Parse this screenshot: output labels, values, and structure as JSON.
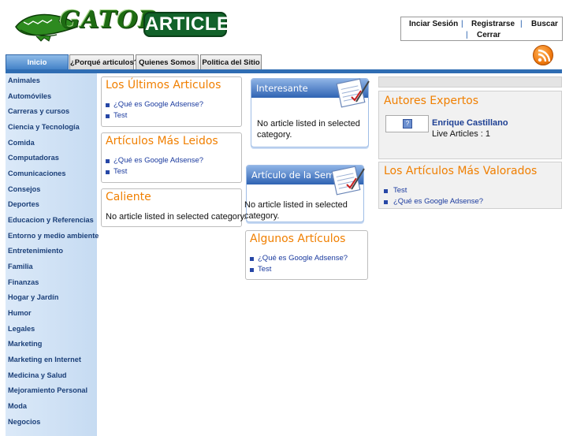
{
  "logo": {
    "gator_text": "GATOR",
    "articles_text": "ARTICLES"
  },
  "topbar": {
    "login": "Inciar Sesión",
    "register": "Registrarse",
    "search": "Buscar",
    "logout": "Cerrar",
    "separator": "|"
  },
  "tabs": [
    {
      "label": "Inicio"
    },
    {
      "label": "¿Porqué articulos?"
    },
    {
      "label": "Quienes Somos"
    },
    {
      "label": "Politica del Sitio"
    }
  ],
  "sidebar": {
    "items": [
      "Animales",
      "Automóviles",
      "Carreras y cursos",
      "Ciencia y Tecnología",
      "Comida",
      "Computadoras",
      "Comunicaciones",
      "Consejos",
      "Deportes",
      "Educacion y Referencias",
      "Entorno y medio ambiente",
      "Entretenimiento",
      "Familia",
      "Finanzas",
      "Hogar y Jardín",
      "Humor",
      "Legales",
      "Marketing",
      "Marketing en Internet",
      "Medicina y Salud",
      "Mejoramiento Personal",
      "Moda",
      "Negocios"
    ]
  },
  "latest": {
    "title": "Los Últimos Articulos",
    "items": [
      "¿Qué es Google Adsense?",
      "Test"
    ]
  },
  "most_read": {
    "title": "Artículos Más Leidos",
    "items": [
      "¿Qué es Google Adsense?",
      "Test"
    ]
  },
  "hot": {
    "title": "Caliente",
    "message": "No article listed in selected category."
  },
  "interesting": {
    "title": "Interesante",
    "message": "No article listed in selected category."
  },
  "week": {
    "title": "Artículo de la Semana",
    "message": "No article listed in selected category."
  },
  "some": {
    "title": "Algunos Artículos",
    "items": [
      "¿Qué es Google Adsense?",
      "Test"
    ]
  },
  "experts": {
    "title": "Autores Expertos",
    "name": "Enrique Castillano",
    "live": "Live Articles : 1",
    "avatar_glyph": "?"
  },
  "top_rated": {
    "title": "Los Artículos Más Valorados",
    "items": [
      "Test",
      "¿Qué es Google Adsense?"
    ]
  },
  "icons": {
    "rss": "rss-icon",
    "notepad": "notepad-icon",
    "logo": "gator-logo"
  }
}
